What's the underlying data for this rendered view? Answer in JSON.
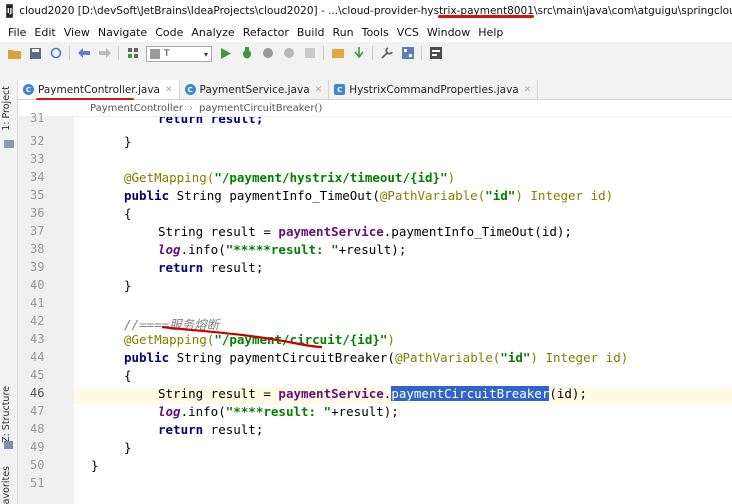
{
  "window": {
    "title": "cloud2020 [D:\\devSoft\\JetBrains\\IdeaProjects\\cloud2020] - ...\\cloud-provider-hystrix-payment8001\\src\\main\\java\\com\\atguigu\\springcloud\\contr",
    "app_icon_text": "IJ"
  },
  "menu": [
    "File",
    "Edit",
    "View",
    "Navigate",
    "Code",
    "Analyze",
    "Refactor",
    "Build",
    "Run",
    "Tools",
    "VCS",
    "Window",
    "Help"
  ],
  "toolbar": {
    "run_config_label": "T"
  },
  "side_tabs": {
    "project": "1: Project",
    "structure": "Z: Structure",
    "favorites": "avorites"
  },
  "tabs": [
    {
      "label": "PaymentController.java",
      "active": true
    },
    {
      "label": "PaymentService.java",
      "active": false
    },
    {
      "label": "HystrixCommandProperties.java",
      "active": false
    }
  ],
  "breadcrumb": {
    "class": "PaymentController",
    "method": "paymentCircuitBreaker()"
  },
  "editor": {
    "line_numbers": [
      "31",
      "32",
      "33",
      "34",
      "35",
      "36",
      "37",
      "38",
      "39",
      "40",
      "41",
      "42",
      "43",
      "44",
      "45",
      "46",
      "47",
      "48",
      "49",
      "50",
      "51"
    ],
    "current_line": "46",
    "code": {
      "l31": "return result;",
      "l32": "}",
      "l34_ann": "@GetMapping(",
      "l34_str": "\"/payment/hystrix/timeout/{id}\"",
      "l34_end": ")",
      "l35_kw": "public",
      "l35_a": " String paymentInfo_TimeOut(",
      "l35_ann": "@PathVariable(",
      "l35_str": "\"id\"",
      "l35_b": ") Integer id)",
      "l36": "{",
      "l37_a": "String result = ",
      "l37_field": "paymentService",
      "l37_b": ".paymentInfo_TimeOut(id);",
      "l38_log": "log",
      "l38_a": ".info(",
      "l38_str": "\"*****result: \"",
      "l38_b": "+result);",
      "l39_kw": "return",
      "l39_b": " result;",
      "l40": "}",
      "l42": "//====服务熔断",
      "l43_ann": "@GetMapping(",
      "l43_str": "\"/payment/circuit/{id}\"",
      "l43_end": ")",
      "l44_kw": "public",
      "l44_a": " String paymentCircuitBreaker(",
      "l44_ann": "@PathVariable(",
      "l44_str": "\"id\"",
      "l44_b": ") Integer id)",
      "l45": "{",
      "l46_a": "String result = ",
      "l46_field": "paymentService",
      "l46_dot": ".",
      "l46_sel": "paymentCircuitBreaker",
      "l46_b": "(id);",
      "l47_log": "log",
      "l47_a": ".info(",
      "l47_str": "\"****result: \"",
      "l47_b": "+result);",
      "l48_kw": "return",
      "l48_b": " result;",
      "l49": "}",
      "l50": "}"
    }
  },
  "colors": {
    "annotation_underline": "#d11111",
    "selection": "#2f65ca",
    "current_line": "#fffae3"
  }
}
